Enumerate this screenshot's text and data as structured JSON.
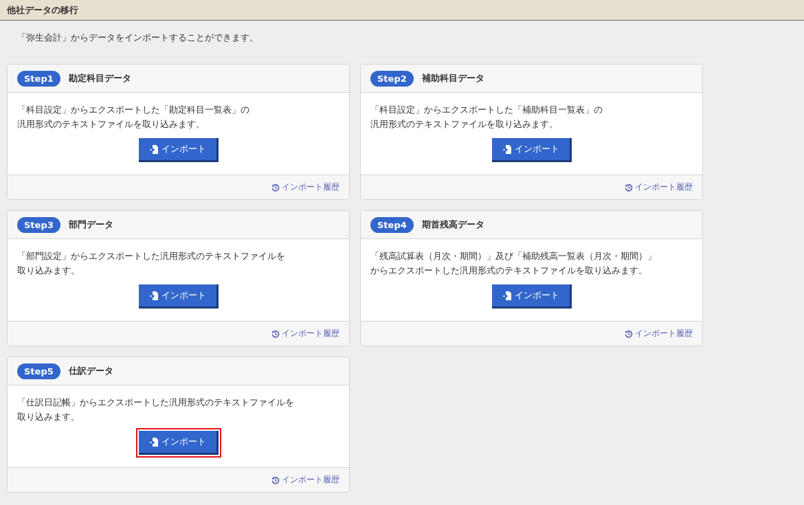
{
  "header": {
    "title": "他社データの移行"
  },
  "intro": "「弥生会計」からデータをインポートすることができます。",
  "steps": [
    {
      "badge": "Step1",
      "title": "勘定科目データ",
      "description": [
        "「科目設定」からエクスポートした「勘定科目一覧表」の",
        "汎用形式のテキストファイルを取り込みます。"
      ],
      "button": "インポート",
      "highlighted": false,
      "history_link": "インポート履歴"
    },
    {
      "badge": "Step2",
      "title": "補助科目データ",
      "description": [
        "「科目設定」からエクスポートした「補助科目一覧表」の",
        "汎用形式のテキストファイルを取り込みます。"
      ],
      "button": "インポート",
      "highlighted": false,
      "history_link": "インポート履歴"
    },
    {
      "badge": "Step3",
      "title": "部門データ",
      "description": [
        "「部門設定」からエクスポートした汎用形式のテキストファイルを",
        "取り込みます。"
      ],
      "button": "インポート",
      "highlighted": false,
      "history_link": "インポート履歴"
    },
    {
      "badge": "Step4",
      "title": "期首残高データ",
      "description": [
        "「残高試算表（月次・期間）」及び「補助残高一覧表（月次・期間）」",
        "からエクスポートした汎用形式のテキストファイルを取り込みます。"
      ],
      "button": "インポート",
      "highlighted": false,
      "history_link": "インポート履歴"
    },
    {
      "badge": "Step5",
      "title": "仕訳データ",
      "description": [
        "「仕訳日記帳」からエクスポートした汎用形式のテキストファイルを",
        "取り込みます。"
      ],
      "button": "インポート",
      "highlighted": true,
      "history_link": "インポート履歴"
    }
  ]
}
